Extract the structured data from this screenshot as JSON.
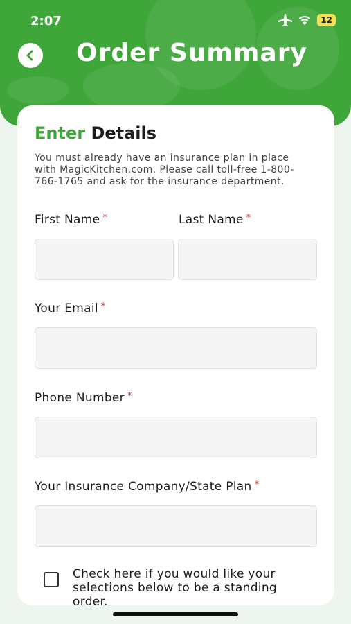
{
  "status_bar": {
    "time": "2:07",
    "battery": "12"
  },
  "header": {
    "title": "Order Summary"
  },
  "form": {
    "heading_accent": "Enter",
    "heading_rest": "Details",
    "intro": "You must already have an insurance plan in place with MagicKitchen.com. Please call toll-free 1-800-766-1765 and ask for the insurance department.",
    "required_mark": "*",
    "first_name": {
      "label": "First Name",
      "value": ""
    },
    "last_name": {
      "label": "Last Name",
      "value": ""
    },
    "email": {
      "label": "Your Email",
      "value": ""
    },
    "phone": {
      "label": "Phone Number",
      "value": ""
    },
    "insurance": {
      "label": "Your Insurance Company/State Plan",
      "value": ""
    },
    "standing_order": {
      "checked": false,
      "label": "Check here if you would like your selections below to be a standing order."
    }
  },
  "colors": {
    "brand_green": "#3fa63a",
    "required_red": "#c62828"
  }
}
